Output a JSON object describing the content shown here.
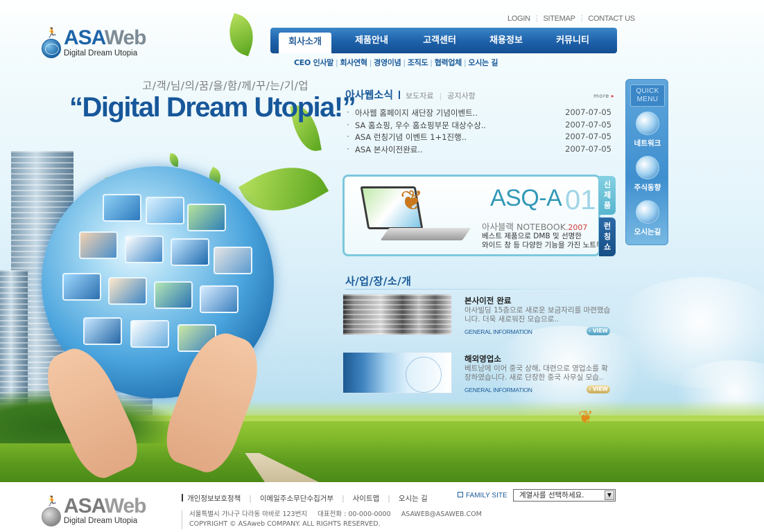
{
  "header": {
    "logo": {
      "brand_asa": "ASA",
      "brand_web": "Web",
      "tagline": "Digital Dream Utopia"
    },
    "util_links": [
      "LOGIN",
      "SITEMAP",
      "CONTACT US"
    ],
    "nav": [
      {
        "label": "회사소개",
        "active": true
      },
      {
        "label": "제품안내",
        "active": false
      },
      {
        "label": "고객센터",
        "active": false
      },
      {
        "label": "채용정보",
        "active": false
      },
      {
        "label": "커뮤니티",
        "active": false
      }
    ],
    "subnav": [
      "CEO 인사말",
      "회사연혁",
      "경영이념",
      "조직도",
      "협력업체",
      "오시는 길"
    ]
  },
  "hero": {
    "slogan_kr": "고/객/님/의/꿈/을/함/께/꾸/는/기/업",
    "slogan_en": "“Digital Dream Utopia!”"
  },
  "news": {
    "title": "아사웹소식",
    "tabs": [
      "보도자료",
      "공지사항"
    ],
    "more_label": "more",
    "items": [
      {
        "title": "아사웹 홈페이지 새단장 기념이벤트..",
        "date": "2007-07-05"
      },
      {
        "title": "SA 홈쇼핑, 우수 홈쇼핑부문 대상수상..",
        "date": "2007-07-05"
      },
      {
        "title": "ASA 런칭기념 이벤트 1+1진행..",
        "date": "2007-07-05"
      },
      {
        "title": "ASA 본사이전완료..",
        "date": "2007-07-05"
      }
    ]
  },
  "promo": {
    "model": "ASQ-A",
    "model_num": "01",
    "subtitle": "아사블랙 NOTEBOOK",
    "year": ".2007",
    "desc_line1": "베스트 제품으로 DMB 및 선명한",
    "desc_line2": "와이드 창 등 다양한 기능을 가진 노트북",
    "tab_new": "신제품",
    "tab_launch": "런칭쇼"
  },
  "business": {
    "title": "사/업/장/소/개",
    "items": [
      {
        "heading": "본사이전 완료",
        "body": "아사빌딩 15층으로 새로운 보금자리를 마련했습니다. 더욱 새로워진 모습으로..",
        "caption": "GENERAL INFORMATION",
        "view_label": "VIEW"
      },
      {
        "heading": "해외영업소",
        "body": "베트남에 이어 중국 상해, 대련으로 영업소를 확장하였습니다. 새로 단장한 중국 사무실 모습..",
        "caption": "GENERAL INFORMATION",
        "view_label": "VIEW"
      }
    ]
  },
  "quick_menu": {
    "title_line1": "QUICK",
    "title_line2": "MENU",
    "items": [
      {
        "label": "네트워크",
        "icon": "globe-network-icon"
      },
      {
        "label": "주식동향",
        "icon": "monitor-chart-icon"
      },
      {
        "label": "오시는길",
        "icon": "compass-icon"
      }
    ]
  },
  "footer": {
    "logo": {
      "brand_asa": "ASA",
      "brand_web": "Web",
      "tagline": "Digital Dream Utopia"
    },
    "links": [
      "개인정보보호정책",
      "이메일주소무단수집거부",
      "사이트맵",
      "오시는 길"
    ],
    "family_label": "FAMILY SITE",
    "family_select_value": "계열사를 선택하세요.",
    "address": "서울특별시 가나구 다라동 마바로 123번지",
    "phone_label": "대표전화 : 00-000-0000",
    "email": "ASAWEB@ASAWEB.COM",
    "copyright": "COPYRIGHT © ASAweb COMPANY. ALL RIGHTS RESERVED."
  },
  "colors": {
    "primary_blue": "#1a5a99",
    "nav_blue": "#1f63ac",
    "accent_teal": "#3198b7",
    "grass_green": "#7fb82a"
  }
}
